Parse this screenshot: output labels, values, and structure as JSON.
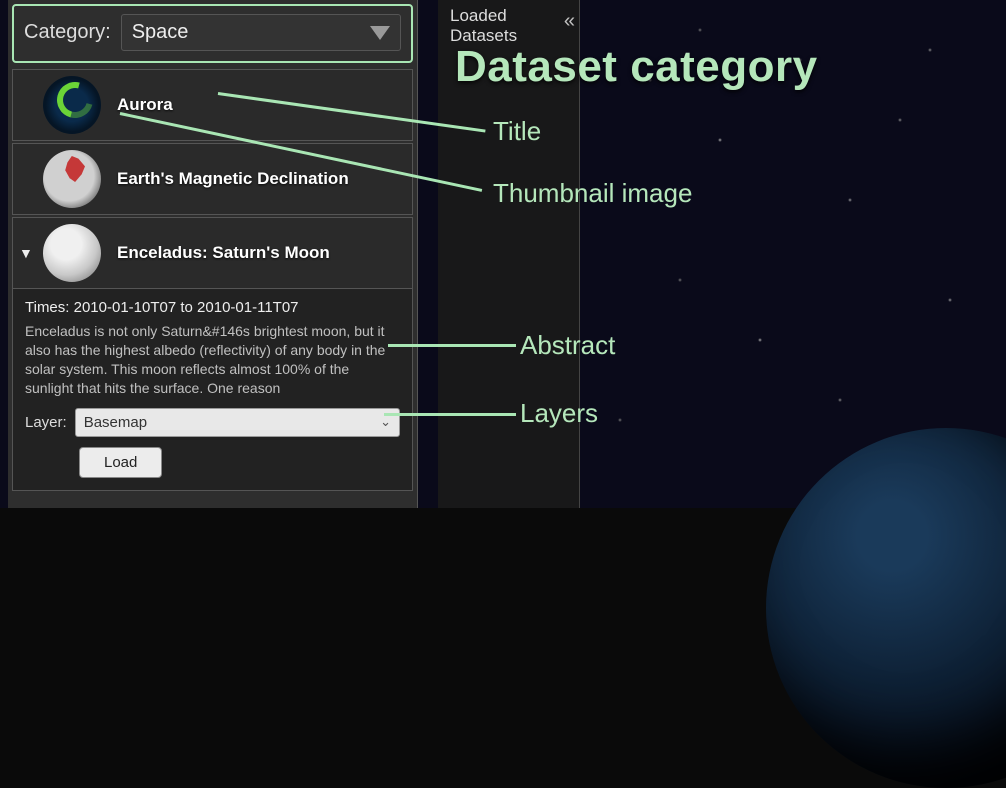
{
  "category": {
    "label": "Category:",
    "selected": "Space"
  },
  "datasets": [
    {
      "title": "Aurora"
    },
    {
      "title": "Earth's Magnetic Declination"
    },
    {
      "title": "Enceladus: Saturn's Moon"
    }
  ],
  "expanded": {
    "times_label": "Times:",
    "times_range": "2010-01-10T07 to 2010-01-11T07",
    "abstract": "Enceladus is not only Saturn&#146s brightest moon, but it also has the highest albedo (reflectivity) of any body in the solar system.  This moon reflects almost 100% of the sunlight that hits the surface.  One reason",
    "layer_label": "Layer:",
    "layer_selected": "Basemap",
    "load_label": "Load"
  },
  "loaded_panel": {
    "title": "Loaded Datasets"
  },
  "annotations": {
    "heading": "Dataset category",
    "title": "Title",
    "thumbnail": "Thumbnail image",
    "abstract": "Abstract",
    "layers": "Layers"
  }
}
